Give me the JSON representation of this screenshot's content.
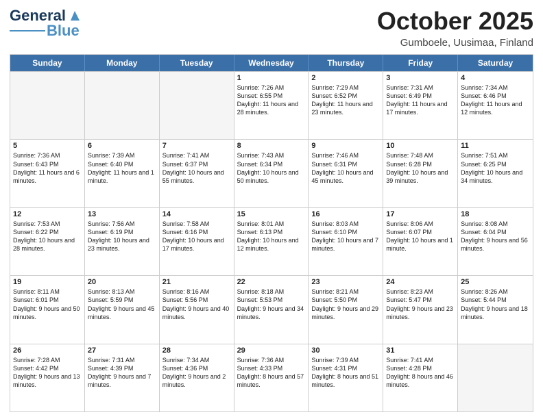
{
  "header": {
    "logo_line1": "General",
    "logo_line2": "Blue",
    "main_title": "October 2025",
    "subtitle": "Gumboele, Uusimaa, Finland"
  },
  "days_of_week": [
    "Sunday",
    "Monday",
    "Tuesday",
    "Wednesday",
    "Thursday",
    "Friday",
    "Saturday"
  ],
  "weeks": [
    [
      {
        "day": "",
        "empty": true
      },
      {
        "day": "",
        "empty": true
      },
      {
        "day": "",
        "empty": true
      },
      {
        "day": "1",
        "sunrise": "Sunrise: 7:26 AM",
        "sunset": "Sunset: 6:55 PM",
        "daylight": "Daylight: 11 hours and 28 minutes."
      },
      {
        "day": "2",
        "sunrise": "Sunrise: 7:29 AM",
        "sunset": "Sunset: 6:52 PM",
        "daylight": "Daylight: 11 hours and 23 minutes."
      },
      {
        "day": "3",
        "sunrise": "Sunrise: 7:31 AM",
        "sunset": "Sunset: 6:49 PM",
        "daylight": "Daylight: 11 hours and 17 minutes."
      },
      {
        "day": "4",
        "sunrise": "Sunrise: 7:34 AM",
        "sunset": "Sunset: 6:46 PM",
        "daylight": "Daylight: 11 hours and 12 minutes."
      }
    ],
    [
      {
        "day": "5",
        "sunrise": "Sunrise: 7:36 AM",
        "sunset": "Sunset: 6:43 PM",
        "daylight": "Daylight: 11 hours and 6 minutes."
      },
      {
        "day": "6",
        "sunrise": "Sunrise: 7:39 AM",
        "sunset": "Sunset: 6:40 PM",
        "daylight": "Daylight: 11 hours and 1 minute."
      },
      {
        "day": "7",
        "sunrise": "Sunrise: 7:41 AM",
        "sunset": "Sunset: 6:37 PM",
        "daylight": "Daylight: 10 hours and 55 minutes."
      },
      {
        "day": "8",
        "sunrise": "Sunrise: 7:43 AM",
        "sunset": "Sunset: 6:34 PM",
        "daylight": "Daylight: 10 hours and 50 minutes."
      },
      {
        "day": "9",
        "sunrise": "Sunrise: 7:46 AM",
        "sunset": "Sunset: 6:31 PM",
        "daylight": "Daylight: 10 hours and 45 minutes."
      },
      {
        "day": "10",
        "sunrise": "Sunrise: 7:48 AM",
        "sunset": "Sunset: 6:28 PM",
        "daylight": "Daylight: 10 hours and 39 minutes."
      },
      {
        "day": "11",
        "sunrise": "Sunrise: 7:51 AM",
        "sunset": "Sunset: 6:25 PM",
        "daylight": "Daylight: 10 hours and 34 minutes."
      }
    ],
    [
      {
        "day": "12",
        "sunrise": "Sunrise: 7:53 AM",
        "sunset": "Sunset: 6:22 PM",
        "daylight": "Daylight: 10 hours and 28 minutes."
      },
      {
        "day": "13",
        "sunrise": "Sunrise: 7:56 AM",
        "sunset": "Sunset: 6:19 PM",
        "daylight": "Daylight: 10 hours and 23 minutes."
      },
      {
        "day": "14",
        "sunrise": "Sunrise: 7:58 AM",
        "sunset": "Sunset: 6:16 PM",
        "daylight": "Daylight: 10 hours and 17 minutes."
      },
      {
        "day": "15",
        "sunrise": "Sunrise: 8:01 AM",
        "sunset": "Sunset: 6:13 PM",
        "daylight": "Daylight: 10 hours and 12 minutes."
      },
      {
        "day": "16",
        "sunrise": "Sunrise: 8:03 AM",
        "sunset": "Sunset: 6:10 PM",
        "daylight": "Daylight: 10 hours and 7 minutes."
      },
      {
        "day": "17",
        "sunrise": "Sunrise: 8:06 AM",
        "sunset": "Sunset: 6:07 PM",
        "daylight": "Daylight: 10 hours and 1 minute."
      },
      {
        "day": "18",
        "sunrise": "Sunrise: 8:08 AM",
        "sunset": "Sunset: 6:04 PM",
        "daylight": "Daylight: 9 hours and 56 minutes."
      }
    ],
    [
      {
        "day": "19",
        "sunrise": "Sunrise: 8:11 AM",
        "sunset": "Sunset: 6:01 PM",
        "daylight": "Daylight: 9 hours and 50 minutes."
      },
      {
        "day": "20",
        "sunrise": "Sunrise: 8:13 AM",
        "sunset": "Sunset: 5:59 PM",
        "daylight": "Daylight: 9 hours and 45 minutes."
      },
      {
        "day": "21",
        "sunrise": "Sunrise: 8:16 AM",
        "sunset": "Sunset: 5:56 PM",
        "daylight": "Daylight: 9 hours and 40 minutes."
      },
      {
        "day": "22",
        "sunrise": "Sunrise: 8:18 AM",
        "sunset": "Sunset: 5:53 PM",
        "daylight": "Daylight: 9 hours and 34 minutes."
      },
      {
        "day": "23",
        "sunrise": "Sunrise: 8:21 AM",
        "sunset": "Sunset: 5:50 PM",
        "daylight": "Daylight: 9 hours and 29 minutes."
      },
      {
        "day": "24",
        "sunrise": "Sunrise: 8:23 AM",
        "sunset": "Sunset: 5:47 PM",
        "daylight": "Daylight: 9 hours and 23 minutes."
      },
      {
        "day": "25",
        "sunrise": "Sunrise: 8:26 AM",
        "sunset": "Sunset: 5:44 PM",
        "daylight": "Daylight: 9 hours and 18 minutes."
      }
    ],
    [
      {
        "day": "26",
        "sunrise": "Sunrise: 7:28 AM",
        "sunset": "Sunset: 4:42 PM",
        "daylight": "Daylight: 9 hours and 13 minutes."
      },
      {
        "day": "27",
        "sunrise": "Sunrise: 7:31 AM",
        "sunset": "Sunset: 4:39 PM",
        "daylight": "Daylight: 9 hours and 7 minutes."
      },
      {
        "day": "28",
        "sunrise": "Sunrise: 7:34 AM",
        "sunset": "Sunset: 4:36 PM",
        "daylight": "Daylight: 9 hours and 2 minutes."
      },
      {
        "day": "29",
        "sunrise": "Sunrise: 7:36 AM",
        "sunset": "Sunset: 4:33 PM",
        "daylight": "Daylight: 8 hours and 57 minutes."
      },
      {
        "day": "30",
        "sunrise": "Sunrise: 7:39 AM",
        "sunset": "Sunset: 4:31 PM",
        "daylight": "Daylight: 8 hours and 51 minutes."
      },
      {
        "day": "31",
        "sunrise": "Sunrise: 7:41 AM",
        "sunset": "Sunset: 4:28 PM",
        "daylight": "Daylight: 8 hours and 46 minutes."
      },
      {
        "day": "",
        "empty": true
      }
    ]
  ]
}
